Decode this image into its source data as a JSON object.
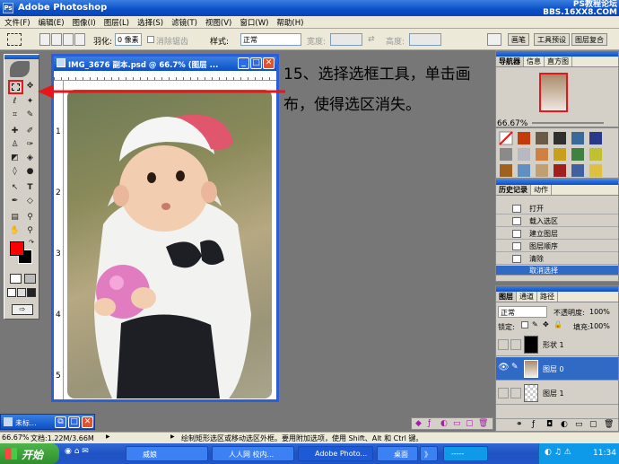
{
  "app": {
    "title": "Adobe Photoshop",
    "watermark_line1": "PS教程论坛",
    "watermark_line2": "BBS.16XX8.COM"
  },
  "menu": [
    "文件(F)",
    "编辑(E)",
    "图像(I)",
    "图层(L)",
    "选择(S)",
    "滤镜(T)",
    "视图(V)",
    "窗口(W)",
    "帮助(H)"
  ],
  "options": {
    "feather_label": "羽化:",
    "feather_value": "0 像素",
    "antialias_label": "消除锯齿",
    "style_label": "样式:",
    "style_value": "正常",
    "width_label": "宽度:",
    "height_label": "高度:",
    "tabs": [
      "画笔",
      "工具预设",
      "图层复合"
    ]
  },
  "document": {
    "title": "IMG_3676 副本.psd @ 66.7% (图层 ...",
    "ruler_marks": [
      "1",
      "2",
      "3",
      "4",
      "5"
    ]
  },
  "annotation": "15、选择选框工具，单击画布，使得选区消失。",
  "colors": {
    "annotation_arrow": "#e8161a",
    "titlebar": "#0a4fc7",
    "foreground": "#ff0000",
    "background": "#000000"
  },
  "navigator": {
    "tabs": [
      "导航器",
      "信息",
      "直方图"
    ],
    "zoom": "66.67%"
  },
  "history": {
    "tabs": [
      "历史记录",
      "动作"
    ],
    "items": [
      "打开",
      "载入选区",
      "建立图层",
      "图层顺序",
      "清除",
      "取消选择"
    ]
  },
  "layers": {
    "tabs": [
      "图层",
      "通道",
      "路径"
    ],
    "blend_mode": "正常",
    "opacity_label": "不透明度:",
    "opacity_value": "100%",
    "lock_label": "锁定:",
    "fill_label": "填充:",
    "fill_value": "100%",
    "items": [
      {
        "name": "形状 1"
      },
      {
        "name": "图层 0"
      },
      {
        "name": "图层 1"
      }
    ]
  },
  "minimized": {
    "title": "未标..."
  },
  "status": {
    "zoom": "66.67%",
    "doc": "文档:1.22M/3.66M",
    "hint": "绘制矩形选区或移动选区外框。要用附加选项，使用 Shift、Alt 和 Ctrl 键。"
  },
  "taskbar": {
    "start": "开始",
    "tasks": [
      "威娘",
      "人人网 校内...",
      "Adobe Photo...",
      "桌面",
      "》",
      "-----"
    ],
    "clock": "11:34"
  }
}
